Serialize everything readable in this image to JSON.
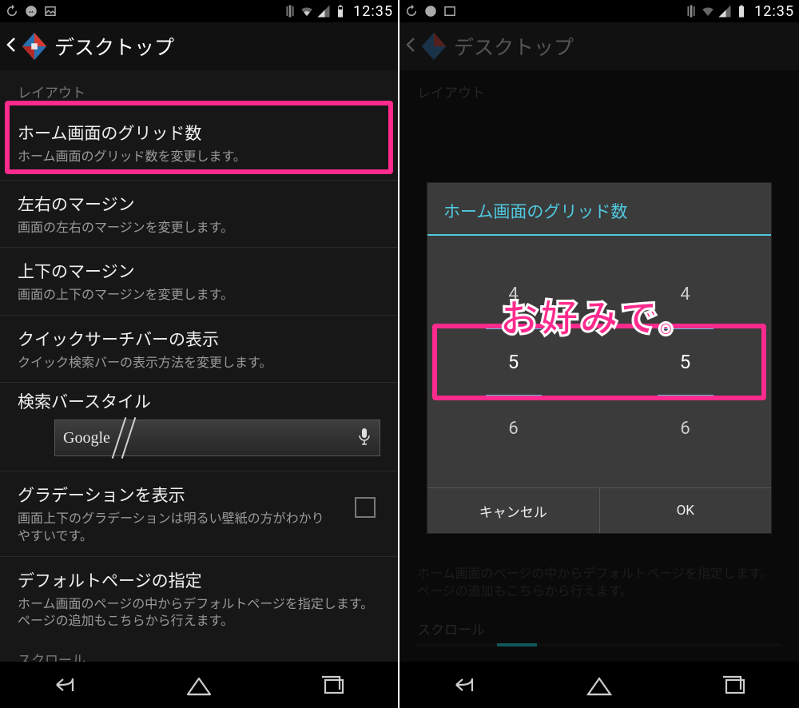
{
  "status": {
    "time": "12:35"
  },
  "actionbar": {
    "title": "デスクトップ"
  },
  "sections": {
    "layout_header": "レイアウト",
    "scroll_header": "スクロール"
  },
  "items": {
    "grid": {
      "title": "ホーム画面のグリッド数",
      "sub": "ホーム画面のグリッド数を変更します。"
    },
    "hmargin": {
      "title": "左右のマージン",
      "sub": "画面の左右のマージンを変更します。"
    },
    "vmargin": {
      "title": "上下のマージン",
      "sub": "画面の上下のマージンを変更します。"
    },
    "qsb": {
      "title": "クイックサーチバーの表示",
      "sub": "クイック検索バーの表示方法を変更します。"
    },
    "style": {
      "title": "検索バースタイル",
      "google": "Google"
    },
    "grad": {
      "title": "グラデーションを表示",
      "sub": "画面上下のグラデーションは明るい壁紙の方がわかりやすいです。"
    },
    "defpage": {
      "title": "デフォルトページの指定",
      "sub": "ホーム画面のページの中からデフォルトページを指定します。ページの追加もこちらから行えます。"
    }
  },
  "dialog": {
    "title": "ホーム画面のグリッド数",
    "col1": {
      "prev": "4",
      "sel": "5",
      "next": "6"
    },
    "col2": {
      "prev": "4",
      "sel": "5",
      "next": "6"
    },
    "cancel": "キャンセル",
    "ok": "OK"
  },
  "callout": "お好みで。"
}
